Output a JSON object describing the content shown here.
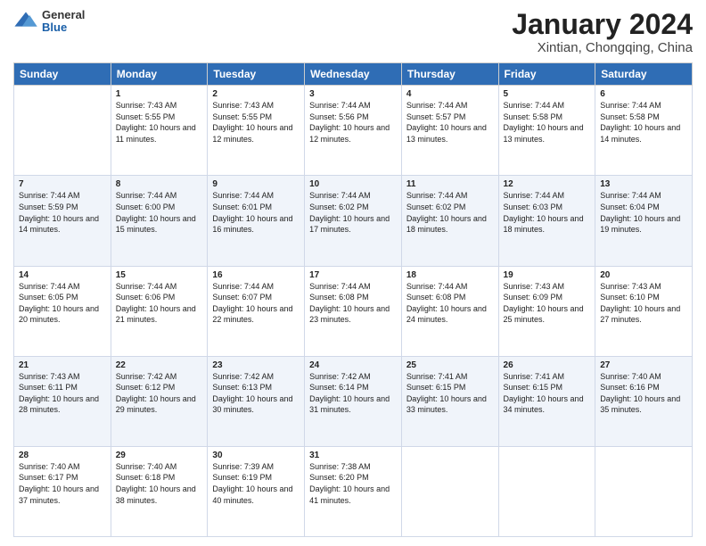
{
  "header": {
    "logo": {
      "general": "General",
      "blue": "Blue"
    },
    "title": "January 2024",
    "subtitle": "Xintian, Chongqing, China"
  },
  "columns": [
    "Sunday",
    "Monday",
    "Tuesday",
    "Wednesday",
    "Thursday",
    "Friday",
    "Saturday"
  ],
  "weeks": [
    [
      {
        "day": "",
        "sunrise": "",
        "sunset": "",
        "daylight": ""
      },
      {
        "day": "1",
        "sunrise": "Sunrise: 7:43 AM",
        "sunset": "Sunset: 5:55 PM",
        "daylight": "Daylight: 10 hours and 11 minutes."
      },
      {
        "day": "2",
        "sunrise": "Sunrise: 7:43 AM",
        "sunset": "Sunset: 5:55 PM",
        "daylight": "Daylight: 10 hours and 12 minutes."
      },
      {
        "day": "3",
        "sunrise": "Sunrise: 7:44 AM",
        "sunset": "Sunset: 5:56 PM",
        "daylight": "Daylight: 10 hours and 12 minutes."
      },
      {
        "day": "4",
        "sunrise": "Sunrise: 7:44 AM",
        "sunset": "Sunset: 5:57 PM",
        "daylight": "Daylight: 10 hours and 13 minutes."
      },
      {
        "day": "5",
        "sunrise": "Sunrise: 7:44 AM",
        "sunset": "Sunset: 5:58 PM",
        "daylight": "Daylight: 10 hours and 13 minutes."
      },
      {
        "day": "6",
        "sunrise": "Sunrise: 7:44 AM",
        "sunset": "Sunset: 5:58 PM",
        "daylight": "Daylight: 10 hours and 14 minutes."
      }
    ],
    [
      {
        "day": "7",
        "sunrise": "Sunrise: 7:44 AM",
        "sunset": "Sunset: 5:59 PM",
        "daylight": "Daylight: 10 hours and 14 minutes."
      },
      {
        "day": "8",
        "sunrise": "Sunrise: 7:44 AM",
        "sunset": "Sunset: 6:00 PM",
        "daylight": "Daylight: 10 hours and 15 minutes."
      },
      {
        "day": "9",
        "sunrise": "Sunrise: 7:44 AM",
        "sunset": "Sunset: 6:01 PM",
        "daylight": "Daylight: 10 hours and 16 minutes."
      },
      {
        "day": "10",
        "sunrise": "Sunrise: 7:44 AM",
        "sunset": "Sunset: 6:02 PM",
        "daylight": "Daylight: 10 hours and 17 minutes."
      },
      {
        "day": "11",
        "sunrise": "Sunrise: 7:44 AM",
        "sunset": "Sunset: 6:02 PM",
        "daylight": "Daylight: 10 hours and 18 minutes."
      },
      {
        "day": "12",
        "sunrise": "Sunrise: 7:44 AM",
        "sunset": "Sunset: 6:03 PM",
        "daylight": "Daylight: 10 hours and 18 minutes."
      },
      {
        "day": "13",
        "sunrise": "Sunrise: 7:44 AM",
        "sunset": "Sunset: 6:04 PM",
        "daylight": "Daylight: 10 hours and 19 minutes."
      }
    ],
    [
      {
        "day": "14",
        "sunrise": "Sunrise: 7:44 AM",
        "sunset": "Sunset: 6:05 PM",
        "daylight": "Daylight: 10 hours and 20 minutes."
      },
      {
        "day": "15",
        "sunrise": "Sunrise: 7:44 AM",
        "sunset": "Sunset: 6:06 PM",
        "daylight": "Daylight: 10 hours and 21 minutes."
      },
      {
        "day": "16",
        "sunrise": "Sunrise: 7:44 AM",
        "sunset": "Sunset: 6:07 PM",
        "daylight": "Daylight: 10 hours and 22 minutes."
      },
      {
        "day": "17",
        "sunrise": "Sunrise: 7:44 AM",
        "sunset": "Sunset: 6:08 PM",
        "daylight": "Daylight: 10 hours and 23 minutes."
      },
      {
        "day": "18",
        "sunrise": "Sunrise: 7:44 AM",
        "sunset": "Sunset: 6:08 PM",
        "daylight": "Daylight: 10 hours and 24 minutes."
      },
      {
        "day": "19",
        "sunrise": "Sunrise: 7:43 AM",
        "sunset": "Sunset: 6:09 PM",
        "daylight": "Daylight: 10 hours and 25 minutes."
      },
      {
        "day": "20",
        "sunrise": "Sunrise: 7:43 AM",
        "sunset": "Sunset: 6:10 PM",
        "daylight": "Daylight: 10 hours and 27 minutes."
      }
    ],
    [
      {
        "day": "21",
        "sunrise": "Sunrise: 7:43 AM",
        "sunset": "Sunset: 6:11 PM",
        "daylight": "Daylight: 10 hours and 28 minutes."
      },
      {
        "day": "22",
        "sunrise": "Sunrise: 7:42 AM",
        "sunset": "Sunset: 6:12 PM",
        "daylight": "Daylight: 10 hours and 29 minutes."
      },
      {
        "day": "23",
        "sunrise": "Sunrise: 7:42 AM",
        "sunset": "Sunset: 6:13 PM",
        "daylight": "Daylight: 10 hours and 30 minutes."
      },
      {
        "day": "24",
        "sunrise": "Sunrise: 7:42 AM",
        "sunset": "Sunset: 6:14 PM",
        "daylight": "Daylight: 10 hours and 31 minutes."
      },
      {
        "day": "25",
        "sunrise": "Sunrise: 7:41 AM",
        "sunset": "Sunset: 6:15 PM",
        "daylight": "Daylight: 10 hours and 33 minutes."
      },
      {
        "day": "26",
        "sunrise": "Sunrise: 7:41 AM",
        "sunset": "Sunset: 6:15 PM",
        "daylight": "Daylight: 10 hours and 34 minutes."
      },
      {
        "day": "27",
        "sunrise": "Sunrise: 7:40 AM",
        "sunset": "Sunset: 6:16 PM",
        "daylight": "Daylight: 10 hours and 35 minutes."
      }
    ],
    [
      {
        "day": "28",
        "sunrise": "Sunrise: 7:40 AM",
        "sunset": "Sunset: 6:17 PM",
        "daylight": "Daylight: 10 hours and 37 minutes."
      },
      {
        "day": "29",
        "sunrise": "Sunrise: 7:40 AM",
        "sunset": "Sunset: 6:18 PM",
        "daylight": "Daylight: 10 hours and 38 minutes."
      },
      {
        "day": "30",
        "sunrise": "Sunrise: 7:39 AM",
        "sunset": "Sunset: 6:19 PM",
        "daylight": "Daylight: 10 hours and 40 minutes."
      },
      {
        "day": "31",
        "sunrise": "Sunrise: 7:38 AM",
        "sunset": "Sunset: 6:20 PM",
        "daylight": "Daylight: 10 hours and 41 minutes."
      },
      {
        "day": "",
        "sunrise": "",
        "sunset": "",
        "daylight": ""
      },
      {
        "day": "",
        "sunrise": "",
        "sunset": "",
        "daylight": ""
      },
      {
        "day": "",
        "sunrise": "",
        "sunset": "",
        "daylight": ""
      }
    ]
  ]
}
